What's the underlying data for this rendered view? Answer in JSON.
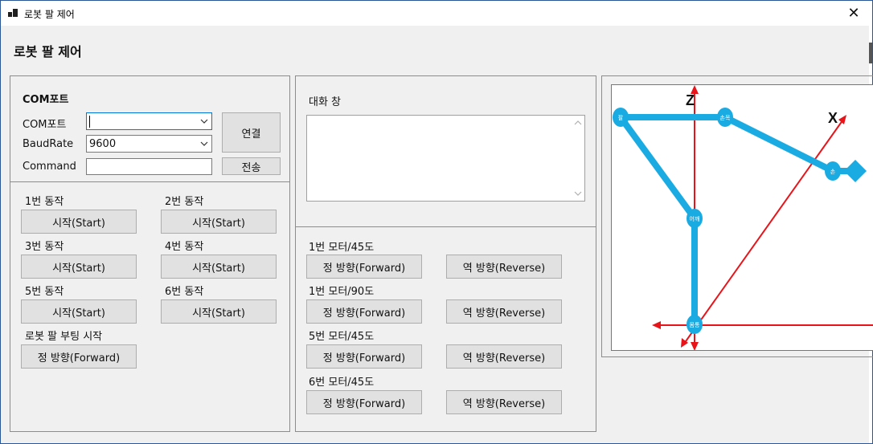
{
  "window": {
    "title": "로봇 팔 제어",
    "close_glyph": "✕"
  },
  "form_title": "로봇 팔 제어",
  "com": {
    "group_label": "COM포트",
    "port_label": "COM포트",
    "port_value": "",
    "baud_label": "BaudRate",
    "baud_value": "9600",
    "command_label": "Command",
    "command_value": "",
    "connect_button": "연결",
    "send_button": "전송"
  },
  "actions": [
    {
      "label": "1번 동작",
      "button": "시작(Start)"
    },
    {
      "label": "2번 동작",
      "button": "시작(Start)"
    },
    {
      "label": "3번 동작",
      "button": "시작(Start)"
    },
    {
      "label": "4번 동작",
      "button": "시작(Start)"
    },
    {
      "label": "5번 동작",
      "button": "시작(Start)"
    },
    {
      "label": "6번 동작",
      "button": "시작(Start)"
    }
  ],
  "boot": {
    "label": "로봇 팔 부팅 시작",
    "button": "정 방향(Forward)"
  },
  "chat": {
    "label": "대화 창",
    "content": ""
  },
  "motors": [
    {
      "label": "1번 모터/45도",
      "forward": "정 방향(Forward)",
      "reverse": "역 방향(Reverse)"
    },
    {
      "label": "1번 모터/90도",
      "forward": "정 방향(Forward)",
      "reverse": "역 방향(Reverse)"
    },
    {
      "label": "5번 모터/45도",
      "forward": "정 방향(Forward)",
      "reverse": "역 방향(Reverse)"
    },
    {
      "label": "6번 모터/45도",
      "forward": "정 방향(Forward)",
      "reverse": "역 방향(Reverse)"
    }
  ],
  "diagram": {
    "axis_z": "Z",
    "axis_x": "X",
    "joints": {
      "arm": "팔",
      "wrist": "손목",
      "hand": "손",
      "shoulder": "어깨",
      "body": "몸통"
    },
    "arm_color": "#1aabe3",
    "axis_color": "#e8141a"
  }
}
